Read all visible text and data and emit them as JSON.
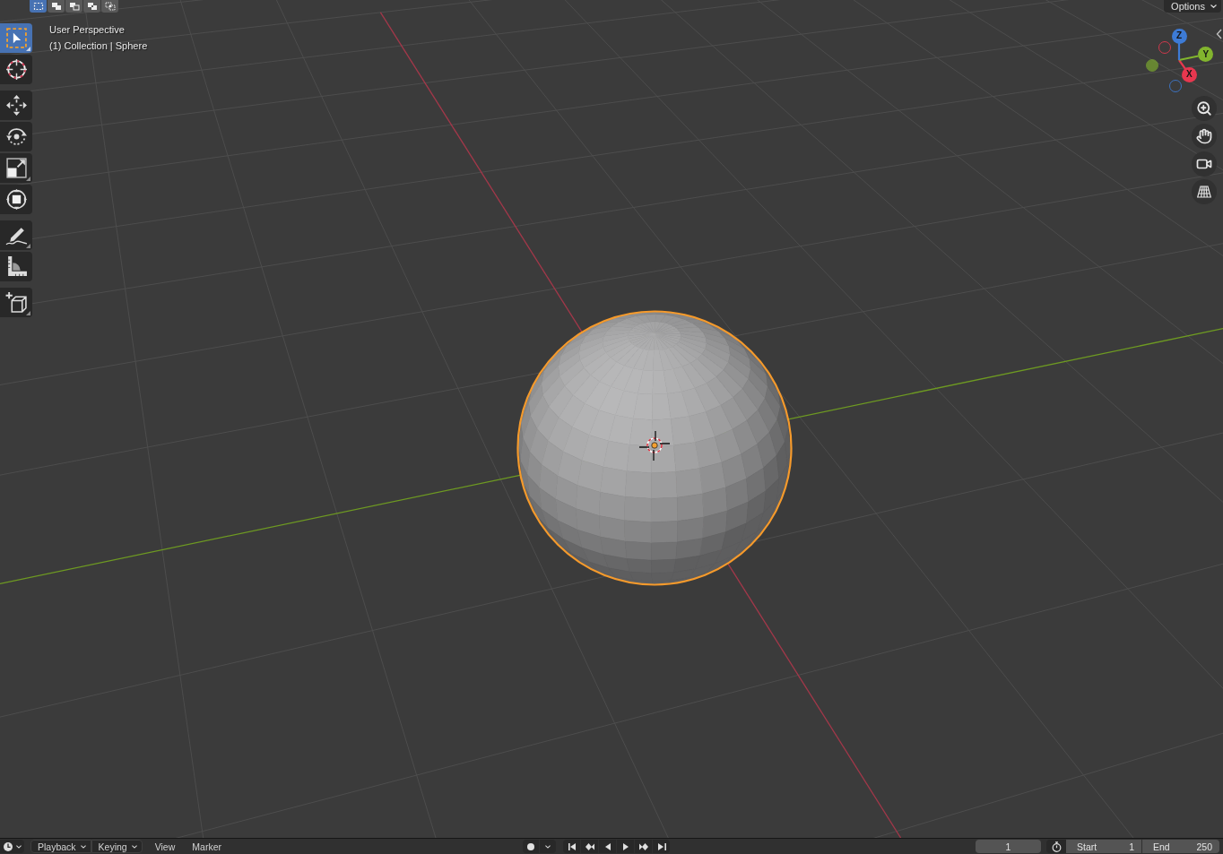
{
  "selection_modes": [
    {
      "kind": "set",
      "selected": true
    },
    {
      "kind": "extend",
      "selected": false
    },
    {
      "kind": "subtract",
      "selected": false
    },
    {
      "kind": "difference",
      "selected": false
    },
    {
      "kind": "intersect",
      "selected": false
    }
  ],
  "toolbar": {
    "groups": [
      {
        "tools": [
          {
            "kind": "select_box",
            "selected": true,
            "has_submenu": true
          },
          {
            "kind": "cursor",
            "selected": false,
            "has_submenu": false
          }
        ]
      },
      {
        "tools": [
          {
            "kind": "move",
            "selected": false,
            "has_submenu": false
          },
          {
            "kind": "rotate",
            "selected": false,
            "has_submenu": false
          },
          {
            "kind": "scale",
            "selected": false,
            "has_submenu": true
          },
          {
            "kind": "transform",
            "selected": false,
            "has_submenu": false
          }
        ]
      },
      {
        "tools": [
          {
            "kind": "annotate",
            "selected": false,
            "has_submenu": true
          },
          {
            "kind": "measure",
            "selected": false,
            "has_submenu": false
          }
        ]
      },
      {
        "tools": [
          {
            "kind": "add_cube",
            "selected": false,
            "has_submenu": true
          }
        ]
      }
    ]
  },
  "viewport": {
    "view_name": "User Perspective",
    "object_info": "(1) Collection | Sphere",
    "options_label": "Options"
  },
  "gizmo": {
    "axes": [
      {
        "label": "X",
        "color": "#e8374f",
        "negative_filled": false
      },
      {
        "label": "Y",
        "color": "#82b42e",
        "negative_filled": true
      },
      {
        "label": "Z",
        "color": "#3d7bd6",
        "negative_filled": false
      }
    ]
  },
  "navigation": [
    {
      "kind": "zoom"
    },
    {
      "kind": "pan"
    },
    {
      "kind": "camera"
    },
    {
      "kind": "perspective"
    }
  ],
  "timeline": {
    "menus": [
      {
        "kind": "dropdown",
        "label": "Playback"
      },
      {
        "kind": "dropdown",
        "label": "Keying"
      },
      {
        "kind": "menu",
        "label": "View"
      },
      {
        "kind": "menu",
        "label": "Marker"
      }
    ],
    "transport": [
      {
        "kind": "jump_start"
      },
      {
        "kind": "prev_keyframe"
      },
      {
        "kind": "play_reverse"
      },
      {
        "kind": "play"
      },
      {
        "kind": "next_keyframe"
      },
      {
        "kind": "jump_end"
      }
    ],
    "current_frame": "1",
    "preview_range": false,
    "range": [
      {
        "label": "Start",
        "value": "1"
      },
      {
        "label": "End",
        "value": "250"
      }
    ]
  }
}
